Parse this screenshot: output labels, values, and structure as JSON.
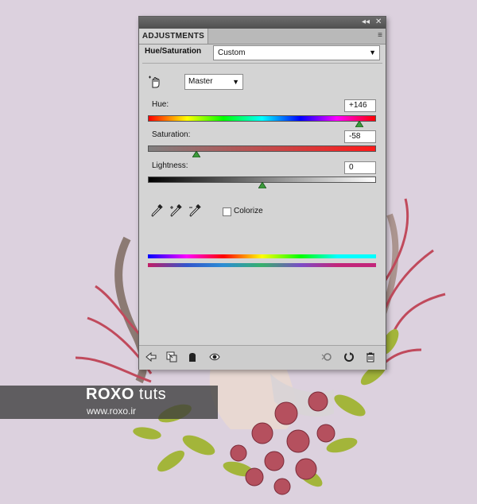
{
  "panel": {
    "tab_label": "ADJUSTMENTS",
    "title_controls": "◂◂ ✕",
    "menu_icon": "≡"
  },
  "header": {
    "label": "Hue/Saturation",
    "preset_value": "Custom"
  },
  "channel": {
    "value": "Master"
  },
  "hue": {
    "label": "Hue:",
    "value": "+146"
  },
  "saturation": {
    "label": "Saturation:",
    "value": "-58"
  },
  "lightness": {
    "label": "Lightness:",
    "value": "0"
  },
  "colorize": {
    "label": "Colorize",
    "checked": false
  },
  "watermark": {
    "brand": "ROXO",
    "brand_suffix": "tuts",
    "site": "www.roxo.ir"
  },
  "colors": {
    "panel_bg": "#d4d4d4",
    "titlebar": "#555555",
    "canvas_bg": "#dcd1de"
  }
}
